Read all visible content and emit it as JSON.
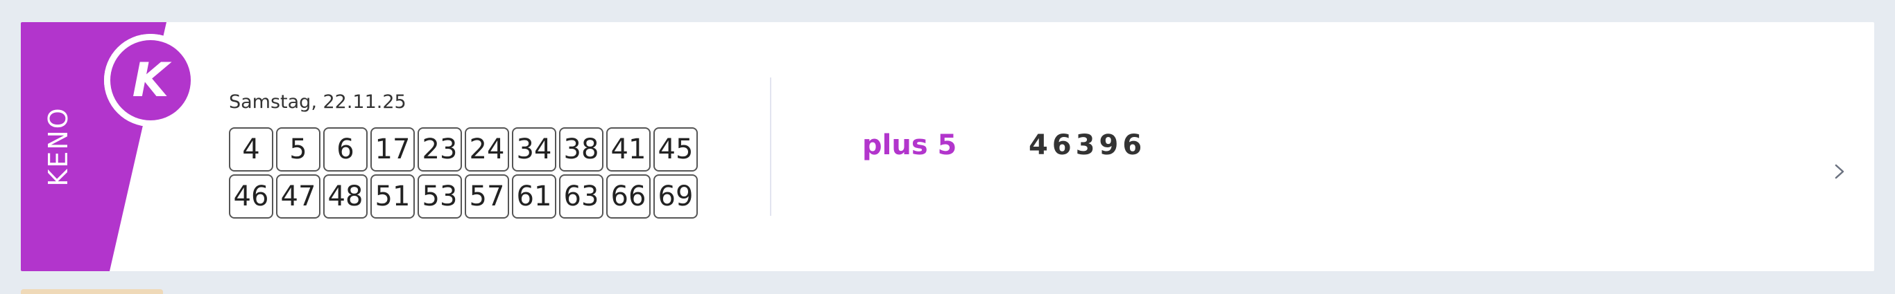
{
  "card": {
    "brand": "KENO",
    "logo_letter": "K",
    "draw_date": "Samstag, 22.11.25",
    "numbers": [
      "4",
      "5",
      "6",
      "17",
      "23",
      "24",
      "34",
      "38",
      "41",
      "45",
      "46",
      "47",
      "48",
      "51",
      "53",
      "57",
      "61",
      "63",
      "66",
      "69"
    ],
    "plus5": {
      "label": "plus 5",
      "number": "46396"
    }
  },
  "colors": {
    "brand_purple": "#b235cc",
    "page_background": "#e6ebf1",
    "card_background": "#ffffff",
    "number_text": "#222222"
  },
  "icons": {
    "logo": "keno-k-logo-icon",
    "details": "chevron-right-icon"
  }
}
